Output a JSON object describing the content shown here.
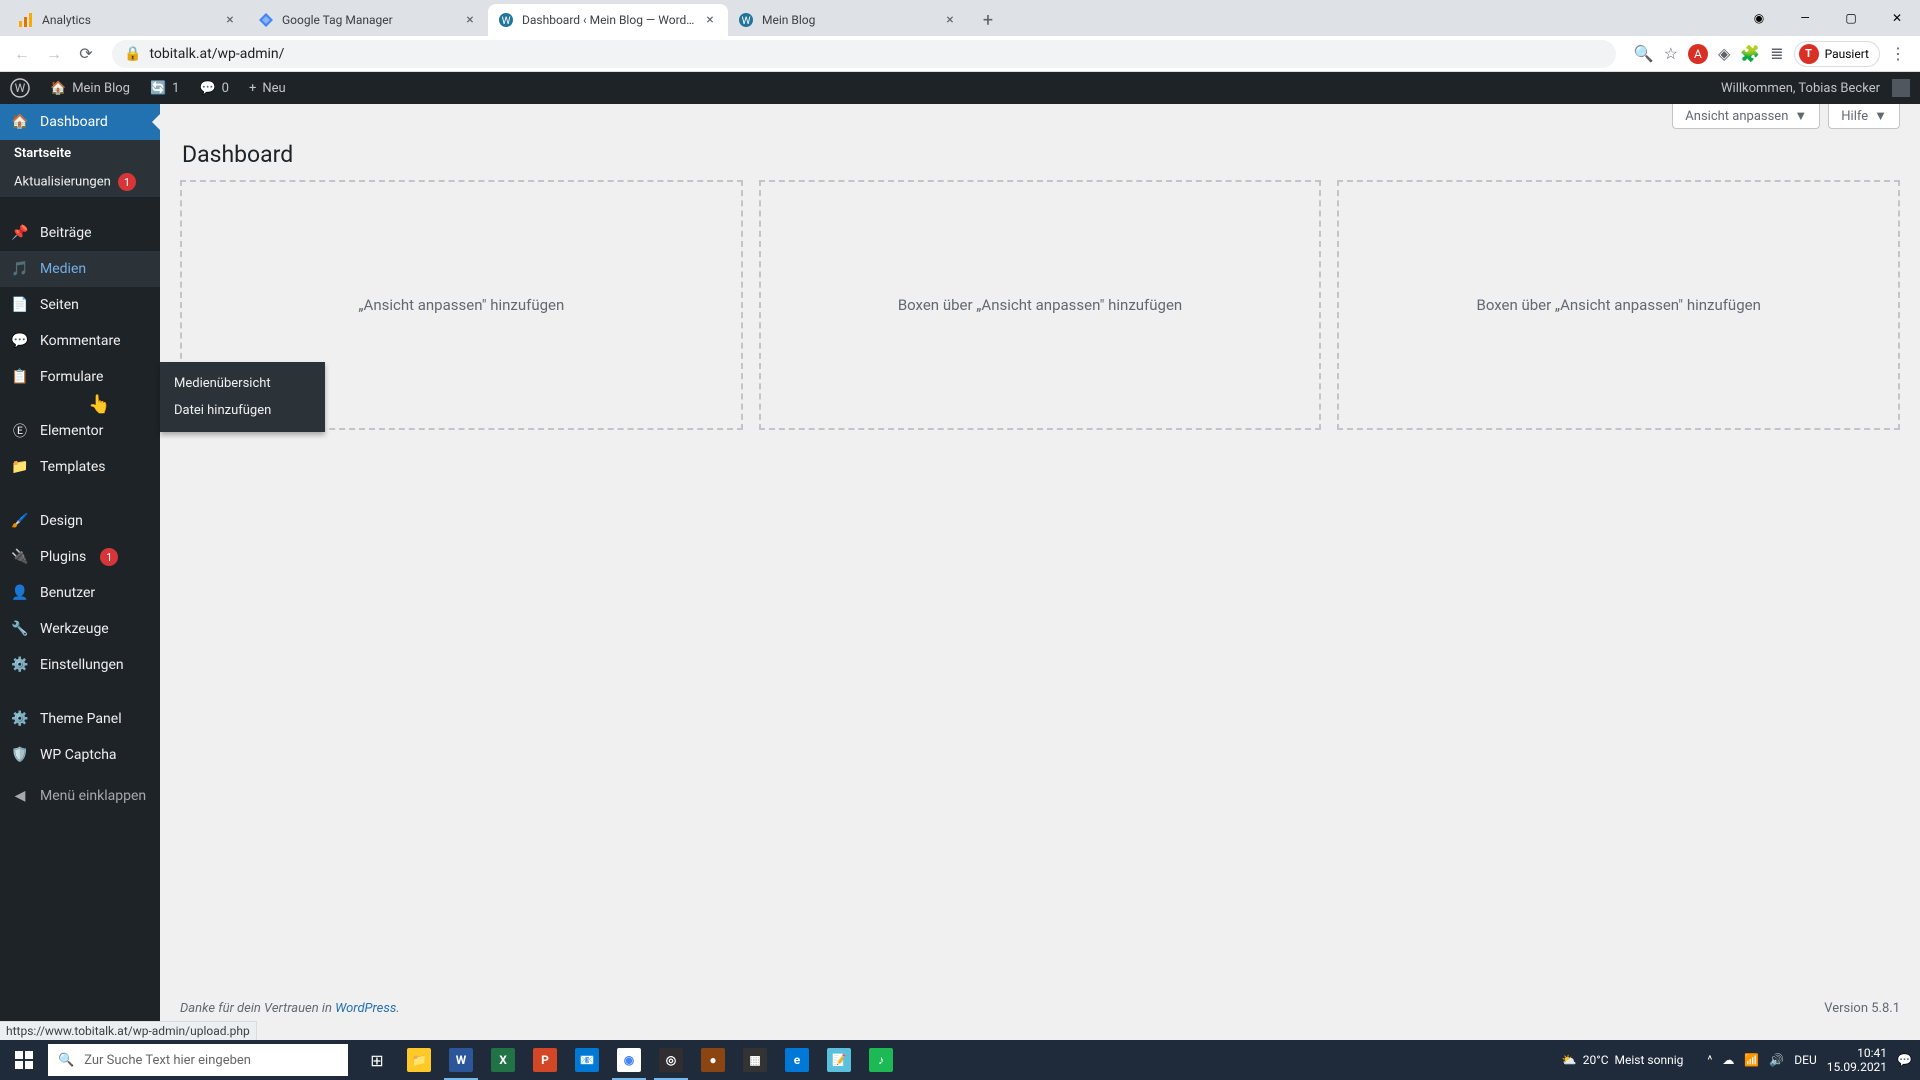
{
  "browser": {
    "tabs": [
      {
        "title": "Analytics",
        "icon_color": "#f9ab00"
      },
      {
        "title": "Google Tag Manager",
        "icon_color": "#4285f4"
      },
      {
        "title": "Dashboard ‹ Mein Blog — WordPress",
        "icon_color": "#21759b",
        "active": true
      },
      {
        "title": "Mein Blog",
        "icon_color": "#21759b"
      }
    ],
    "url": "tobitalk.at/wp-admin/",
    "profile_label": "Pausiert",
    "profile_initial": "T"
  },
  "adminbar": {
    "site_name": "Mein Blog",
    "updates": "1",
    "comments": "0",
    "new": "Neu",
    "greeting": "Willkommen, Tobias Becker"
  },
  "sidebar": {
    "dashboard": "Dashboard",
    "start": "Startseite",
    "updates": "Aktualisierungen",
    "updates_count": "1",
    "posts": "Beiträge",
    "media": "Medien",
    "pages": "Seiten",
    "comments": "Kommentare",
    "forms": "Formulare",
    "elementor": "Elementor",
    "templates": "Templates",
    "appearance": "Design",
    "plugins": "Plugins",
    "plugins_count": "1",
    "users": "Benutzer",
    "tools": "Werkzeuge",
    "settings": "Einstellungen",
    "themepanel": "Theme Panel",
    "wpcaptcha": "WP Captcha",
    "collapse": "Menü einklappen"
  },
  "flyout": {
    "overview": "Medienübersicht",
    "addnew": "Datei hinzufügen"
  },
  "content": {
    "heading": "Dashboard",
    "screen_options": "Ansicht anpassen",
    "help": "Hilfe",
    "box_text_1": "„Ansicht anpassen\" hinzufügen",
    "box_text_2": "Boxen über „Ansicht anpassen\" hinzufügen",
    "box_text_3": "Boxen über „Ansicht anpassen\" hinzufügen",
    "footer_thanks": "Danke für dein Vertrauen in ",
    "footer_link": "WordPress",
    "footer_dot": ".",
    "version": "Version 5.8.1"
  },
  "status_url": "https://www.tobitalk.at/wp-admin/upload.php",
  "taskbar": {
    "search_placeholder": "Zur Suche Text hier eingeben",
    "weather_temp": "20°C",
    "weather_desc": "Meist sonnig",
    "lang": "DEU",
    "time": "10:41",
    "date": "15.09.2021"
  }
}
